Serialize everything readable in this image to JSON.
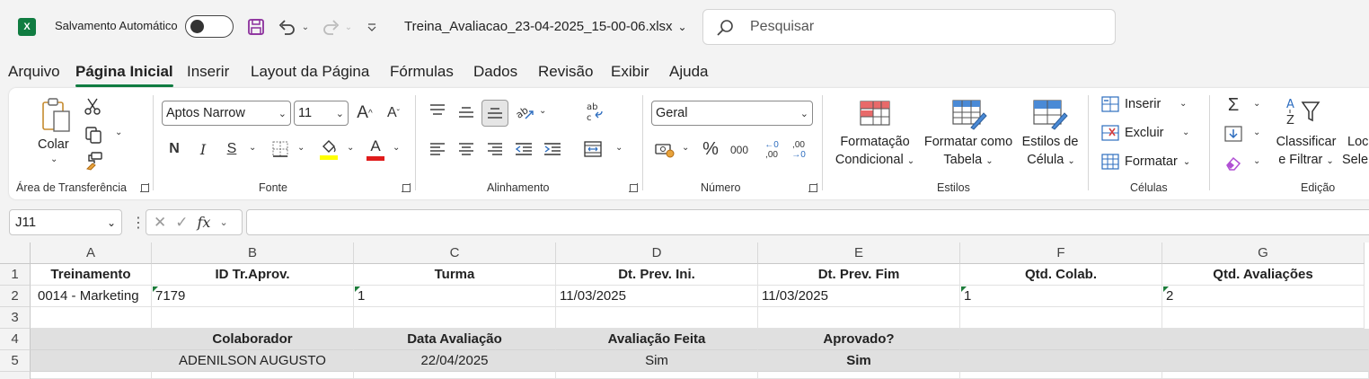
{
  "app": {
    "logo_letter": "X",
    "autosave_label": "Salvamento Automático",
    "document_title": "Treina_Avaliacao_23-04-2025_15-00-06.xlsx",
    "search_placeholder": "Pesquisar",
    "accent_color": "#107c41"
  },
  "tabs": [
    {
      "label": "Arquivo",
      "active": false
    },
    {
      "label": "Página Inicial",
      "active": true
    },
    {
      "label": "Inserir",
      "active": false
    },
    {
      "label": "Layout da Página",
      "active": false
    },
    {
      "label": "Fórmulas",
      "active": false
    },
    {
      "label": "Dados",
      "active": false
    },
    {
      "label": "Revisão",
      "active": false
    },
    {
      "label": "Exibir",
      "active": false
    },
    {
      "label": "Ajuda",
      "active": false
    }
  ],
  "ribbon": {
    "clipboard": {
      "label": "Área de Transferência",
      "paste_label": "Colar"
    },
    "font": {
      "label": "Fonte",
      "font_name": "Aptos Narrow",
      "font_size": "11",
      "bold": "N",
      "italic": "I",
      "underline": "S",
      "grow": "A",
      "shrink": "A",
      "color_a": "A"
    },
    "alignment": {
      "label": "Alinhamento"
    },
    "number": {
      "label": "Número",
      "format": "Geral",
      "percent": "%",
      "thousands": "000",
      "inc_decimal": ",00",
      "dec_decimal": ",00"
    },
    "styles": {
      "label": "Estilos",
      "cond_format_1": "Formatação",
      "cond_format_2": "Condicional",
      "as_table_1": "Formatar como",
      "as_table_2": "Tabela",
      "cell_styles_1": "Estilos de",
      "cell_styles_2": "Célula"
    },
    "cells": {
      "label": "Células",
      "insert": "Inserir",
      "delete": "Excluir",
      "format": "Formatar"
    },
    "editing": {
      "label": "Edição",
      "sort_1": "Classificar",
      "sort_2": "e Filtrar",
      "find_1": "Loc",
      "find_2": "Sele"
    }
  },
  "formula_bar": {
    "name_box": "J11",
    "fx": "fx",
    "content": ""
  },
  "grid": {
    "columns": [
      "A",
      "B",
      "C",
      "D",
      "E",
      "F",
      "G"
    ],
    "rows": [
      "1",
      "2",
      "3",
      "4",
      "5"
    ],
    "row1": [
      "Treinamento",
      "ID Tr.Aprov.",
      "Turma",
      "Dt. Prev. Ini.",
      "Dt. Prev. Fim",
      "Qtd. Colab.",
      "Qtd. Avaliações"
    ],
    "row2": [
      "0014 - Marketing",
      "7179",
      "1",
      "11/03/2025",
      "11/03/2025",
      "1",
      "2"
    ],
    "row4": [
      "",
      "Colaborador",
      "Data Avaliação",
      "Avaliação Feita",
      "Aprovado?",
      "",
      ""
    ],
    "row5": [
      "",
      "ADENILSON AUGUSTO",
      "22/04/2025",
      "Sim",
      "Sim",
      "",
      ""
    ]
  }
}
